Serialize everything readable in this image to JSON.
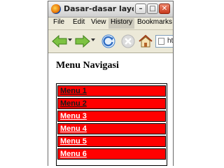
{
  "window": {
    "title": "Dasar-dasar layout ...",
    "minimize_glyph": "–",
    "maximize_glyph": "□",
    "close_glyph": "✕"
  },
  "menubar": {
    "items": [
      {
        "label": "File"
      },
      {
        "label": "Edit"
      },
      {
        "label": "View"
      },
      {
        "label": "History"
      },
      {
        "label": "Bookmarks"
      }
    ]
  },
  "toolbar": {
    "back_icon": "back-arrow-icon",
    "forward_icon": "forward-arrow-icon",
    "reload_icon": "reload-icon",
    "stop_icon": "stop-icon",
    "home_icon": "home-icon",
    "url_text": "ht"
  },
  "page": {
    "heading": "Menu Navigasi",
    "nav_items": [
      {
        "label": "Menu 1"
      },
      {
        "label": "Menu 2"
      },
      {
        "label": "Menu 3"
      },
      {
        "label": "Menu 4"
      },
      {
        "label": "Menu 5"
      },
      {
        "label": "Menu 6"
      }
    ]
  },
  "colors": {
    "nav_background": "#ff0000",
    "nav_text": "#ffffff",
    "nav_border": "#000000"
  }
}
